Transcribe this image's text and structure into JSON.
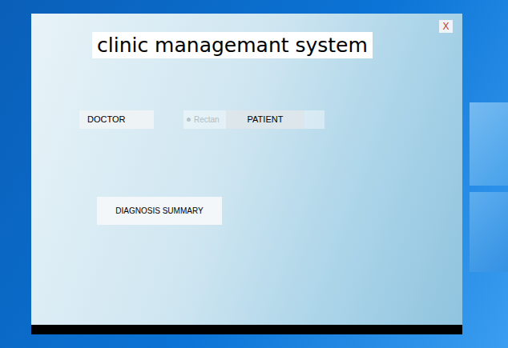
{
  "window": {
    "title": "clinic managemant system",
    "close": "X"
  },
  "buttons": [
    {
      "label": "DOCTOR"
    },
    {
      "label": "PATIENT"
    },
    {
      "label": "DIAGNOSIS SUMMARY"
    }
  ],
  "shape": {
    "label": "Rectan"
  }
}
